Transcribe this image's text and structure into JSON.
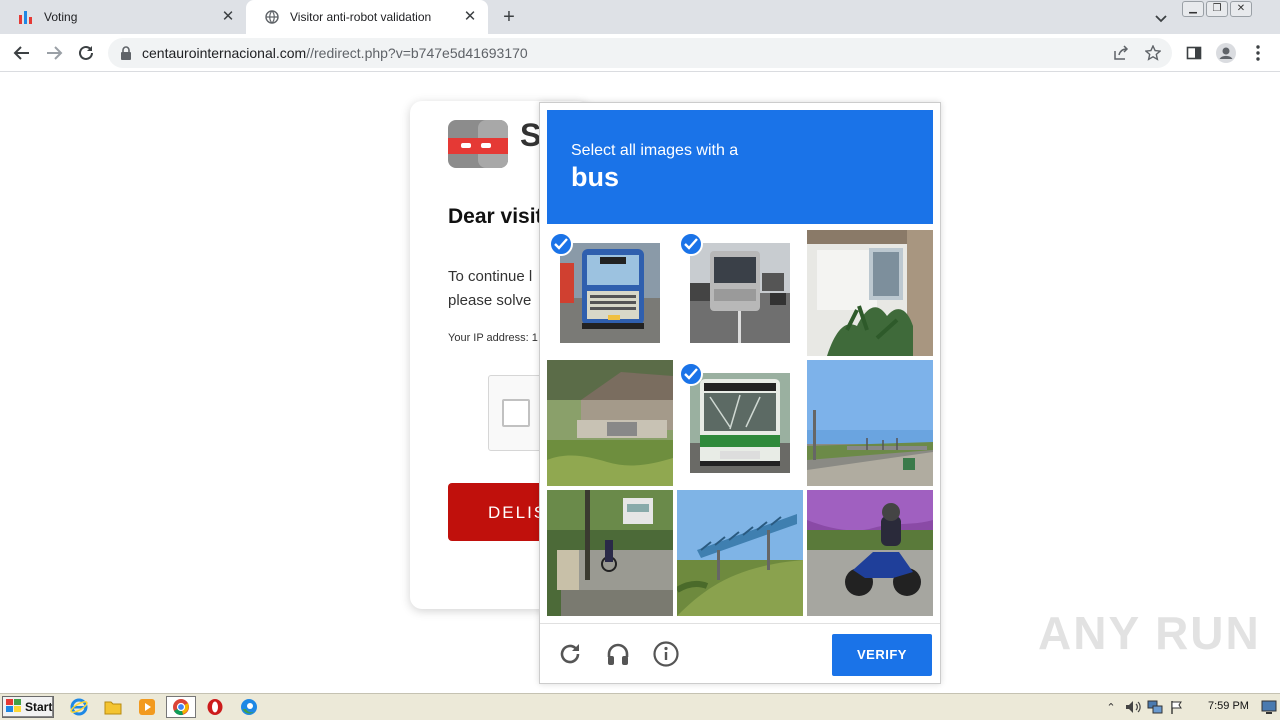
{
  "browser": {
    "tabs": [
      {
        "title": "Voting",
        "favicon": "chart-favicon",
        "active": false
      },
      {
        "title": "Visitor anti-robot validation",
        "favicon": "globe-favicon",
        "active": true
      }
    ],
    "new_tab_icon": "plus-icon",
    "window_controls": [
      "minimize",
      "restore",
      "close"
    ],
    "address": {
      "host": "centauroint ernacional.com",
      "host_clean": "centaurointernacional.com",
      "path": "//redirect.php?v=b747e5d41693170"
    }
  },
  "page": {
    "logo_letter": "S",
    "heading": "Dear visit",
    "para_line1": "To continue l",
    "para_line2": "please solve",
    "ip_label": "Your IP address: 1",
    "button_label": "DELIS"
  },
  "captcha": {
    "instruction": "Select all images with a",
    "target": "bus",
    "tiles": [
      {
        "name": "bus-front-tile",
        "selected": true
      },
      {
        "name": "bus-road-tile",
        "selected": true
      },
      {
        "name": "house-porch-tile",
        "selected": false
      },
      {
        "name": "shed-field-tile",
        "selected": false
      },
      {
        "name": "green-bus-tile",
        "selected": true
      },
      {
        "name": "highway-sky-tile",
        "selected": false
      },
      {
        "name": "street-bike-tile",
        "selected": false
      },
      {
        "name": "bridge-tile",
        "selected": false
      },
      {
        "name": "motorcycle-tile",
        "selected": false
      }
    ],
    "verify_label": "VERIFY",
    "footer_icons": [
      "reload-icon",
      "audio-icon",
      "info-icon"
    ]
  },
  "watermark": "ANY RUN",
  "taskbar": {
    "start_label": "Start",
    "apps": [
      "ie-icon",
      "folder-icon",
      "media-player-icon",
      "chrome-icon",
      "opera-icon",
      "edge-icon"
    ],
    "clock": "7:59 PM"
  },
  "colors": {
    "accent": "#1a73e8",
    "danger": "#c0100c"
  }
}
